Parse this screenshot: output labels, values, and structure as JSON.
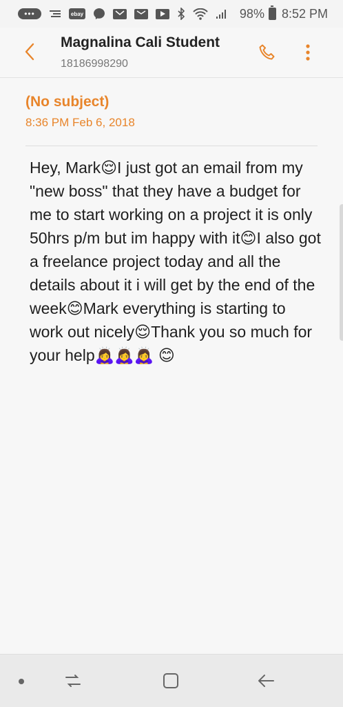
{
  "status_bar": {
    "battery": "98%",
    "time": "8:52 PM",
    "left_icons": [
      "more-notifications-icon",
      "nfc-icon",
      "ebay-icon",
      "messenger-icon",
      "gmail-icon",
      "email-icon",
      "youtube-icon",
      "bluetooth-icon",
      "wifi-icon",
      "signal-icon"
    ],
    "ebay_text": "ebay",
    "pill_text": "•••"
  },
  "header": {
    "contact_name": "Magnalina Cali Student",
    "contact_number": "18186998290"
  },
  "message": {
    "subject": "(No subject)",
    "timestamp": "8:36 PM  Feb 6, 2018",
    "body": "Hey, Mark😌I just got an email from my \"new boss\" that they have a budget for me to start working on a project it is only 50hrs p/m but im happy with it😊I also got a freelance project today and all the details about it i will get by the end of the week😊Mark everything is starting to work out nicely😌Thank you so much for your help🙇‍♀️🙇‍♀️🙇‍♀️ 😊"
  },
  "colors": {
    "accent": "#e8852b",
    "text": "#1e1e1e",
    "background": "#f7f7f7"
  }
}
